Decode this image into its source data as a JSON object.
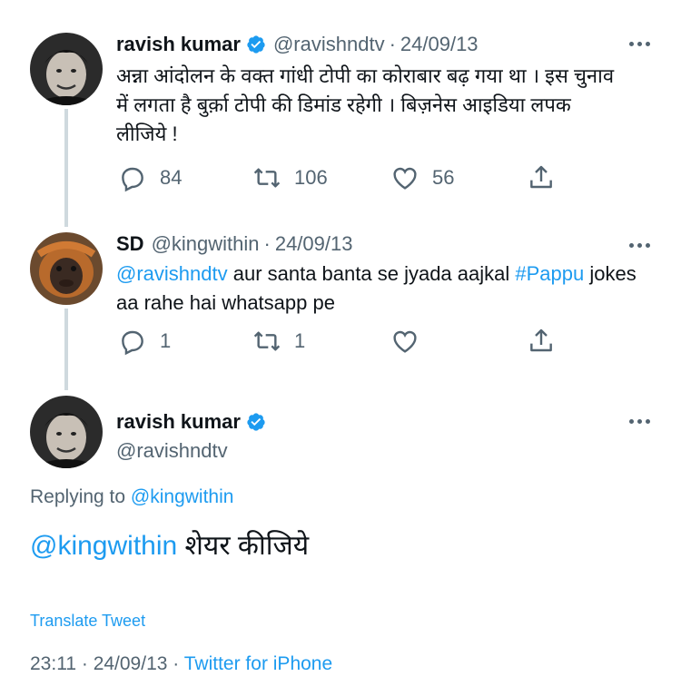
{
  "tweets": [
    {
      "name": "ravish kumar",
      "verified": true,
      "handle": "@ravishndtv",
      "separator": "·",
      "date": "24/09/13",
      "text": "अन्ना आंदोलन के वक्त गांधी टोपी का कोराबार बढ़ गया था । इस चुनाव में लगता है बुर्क़ा टोपी की डिमांड रहेगी । बिज़नेस आइडिया लपक लीजिये !",
      "replies": "84",
      "retweets": "106",
      "likes": "56"
    },
    {
      "name": "SD",
      "verified": false,
      "handle": "@kingwithin",
      "separator": "·",
      "date": "24/09/13",
      "text_mention": "@ravishndtv",
      "text_part1": " aur santa banta se jyada aajkal ",
      "text_hashtag": "#Pappu",
      "text_part2": " jokes aa rahe hai whatsapp pe",
      "replies": "1",
      "retweets": "1",
      "likes": ""
    }
  ],
  "focus": {
    "name": "ravish kumar",
    "verified": true,
    "handle": "@ravishndtv",
    "replying_label": "Replying to",
    "replying_handle": "@kingwithin",
    "text_mention": "@kingwithin",
    "text_rest": " शेयर कीजिये",
    "translate_label": "Translate Tweet",
    "time": "23:11",
    "separator": "·",
    "date": "24/09/13",
    "source": "Twitter for iPhone"
  },
  "colors": {
    "accent": "#1d9bf0",
    "secondary_text": "#536471",
    "thread_line": "#cfd9de"
  },
  "icons": [
    "verified-badge-icon",
    "more-icon",
    "reply-icon",
    "retweet-icon",
    "like-icon",
    "share-icon"
  ]
}
